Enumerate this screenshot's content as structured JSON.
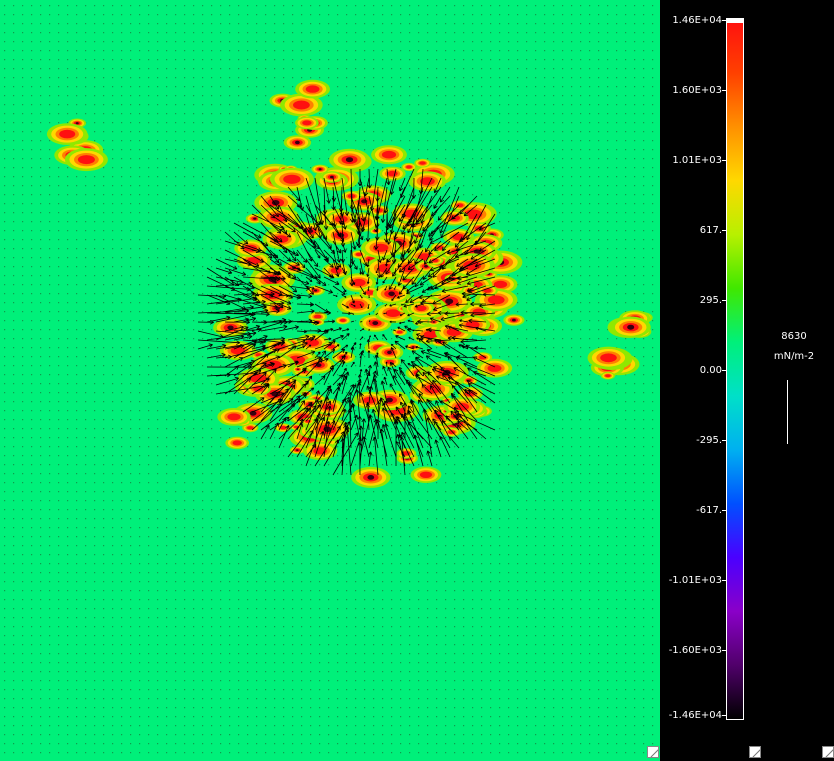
{
  "colorbar": {
    "ticks": [
      "1.46E+04",
      "1.60E+03",
      "1.01E+03",
      "617.",
      "295.",
      "0.00",
      "-295.",
      "-617.",
      "-1.01E+03",
      "-1.60E+03",
      "-1.46E+04"
    ],
    "gradient_colors": [
      "#ff1010",
      "#ff4000",
      "#ff9000",
      "#ffd800",
      "#b8f000",
      "#40e800",
      "#00f07a",
      "#00e0c8",
      "#00b0f0",
      "#0050ff",
      "#4a00ff",
      "#8a00c8",
      "#50006a",
      "#000000"
    ]
  },
  "scale": {
    "value": "8630",
    "unit": "mN/m-2"
  },
  "field": {
    "background_color": "#00f07a",
    "arrow_color": "#000000",
    "hotspot_colors": [
      "#ff1010",
      "#ff8000",
      "#ffd800",
      "#90e800"
    ]
  }
}
